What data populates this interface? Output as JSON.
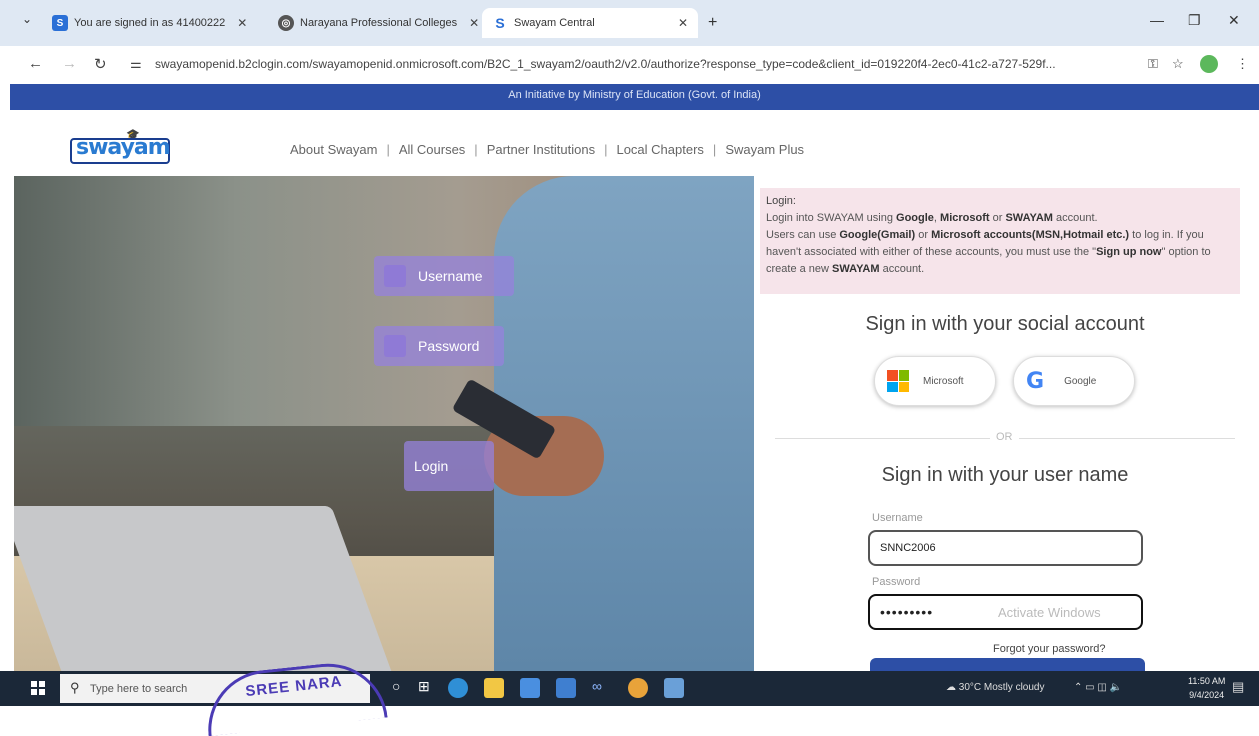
{
  "tabs": [
    {
      "title": "You are signed in as 41400222",
      "icon": "s-badge-icon",
      "color": "#2a6fd6"
    },
    {
      "title": "Narayana Professional Colleges",
      "icon": "globe-icon",
      "color": "#555555"
    },
    {
      "title": "Swayam Central",
      "icon": "swayam-s-icon",
      "color": "#2a6fd6"
    }
  ],
  "address_bar": {
    "url": "swayamopenid.b2clogin.com/swayamopenid.onmicrosoft.com/B2C_1_swayam2/oauth2/v2.0/authorize?response_type=code&client_id=019220f4-2ec0-41c2-a727-529f..."
  },
  "banner": "An Initiative by Ministry of Education (Govt. of India)",
  "logo": {
    "text": "swayam"
  },
  "topnav": [
    "About Swayam",
    "All Courses",
    "Partner Institutions",
    "Local Chapters",
    "Swayam Plus"
  ],
  "hero_chips": {
    "username": "Username",
    "password": "Password",
    "login": "Login"
  },
  "info": {
    "heading": "Login:",
    "line1_pre": "Login into SWAYAM using ",
    "line1_google": "Google",
    "line1_microsoft": "Microsoft",
    "line1_or": " or ",
    "line1_swayam": "SWAYAM",
    "line1_post": " account.",
    "line2_pre": "Users can use ",
    "line2_gmail": "Google(Gmail)",
    "line2_or": " or ",
    "line2_ms": "Microsoft accounts(MSN,Hotmail etc.)",
    "line2_post": " to log in. If you haven't associated with either of these accounts, you must use the \"",
    "line2_signup": "Sign up now",
    "line2_post2": "\" option to create a new ",
    "line2_swayam": "SWAYAM",
    "line2_end": " account."
  },
  "social": {
    "heading": "Sign in with your social account",
    "microsoft": "Microsoft",
    "google": "Google"
  },
  "or_text": "OR",
  "user_login": {
    "heading": "Sign in with your user name",
    "username_label": "Username",
    "username_value": "SNNC2006",
    "password_label": "Password",
    "password_value": "•••••••••",
    "forgot": "Forgot your password?"
  },
  "watermark": "Activate Windows",
  "taskbar": {
    "search_placeholder": "Type here to search",
    "stamp": "SREE NARA",
    "weather": "30°C  Mostly cloudy",
    "time": "11:50 AM",
    "date": "9/4/2024"
  }
}
